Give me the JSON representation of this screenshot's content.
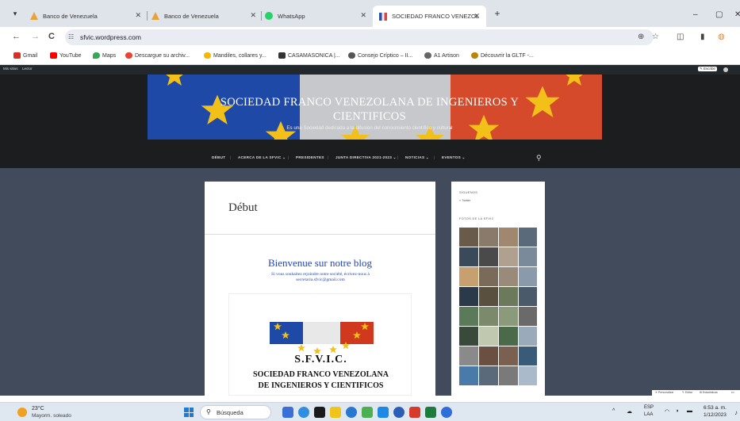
{
  "browser": {
    "tabs": [
      {
        "label": "Banco de Venezuela",
        "favicon_color": "#e8a33c"
      },
      {
        "label": "Banco de Venezuela",
        "favicon_color": "#e8a33c"
      },
      {
        "label": "WhatsApp",
        "favicon_color": "#25d366"
      },
      {
        "label": "SOCIEDAD FRANCO VENEZOLA",
        "favicon_color": "#c0392b"
      }
    ],
    "url": "sfvic.wordpress.com",
    "icons": {
      "tab_menu": "▾",
      "close": "✕",
      "new_tab": "+",
      "minimize": "–",
      "maximize": "▢",
      "back": "←",
      "forward": "→",
      "reload": "C",
      "tune": "☷",
      "zoom": "⊕",
      "star": "☆",
      "extensions": "◫",
      "sidepanel": "▮",
      "profile": "◍"
    }
  },
  "bookmarks": [
    {
      "label": "Gmail",
      "color": "#d93025"
    },
    {
      "label": "YouTube",
      "color": "#ff0000"
    },
    {
      "label": "Maps",
      "color": "#34a853"
    },
    {
      "label": "Descargue su archiv...",
      "color": "#ea4335"
    },
    {
      "label": "Mandiles, collares y...",
      "color": "#f2b900"
    },
    {
      "label": "CASAMASONICA |...",
      "color": "#333333"
    },
    {
      "label": "Consejo Críptico – II...",
      "color": "#555555"
    },
    {
      "label": "A1 Artison",
      "color": "#666666"
    },
    {
      "label": "Découvrir la GLTF -...",
      "color": "#b8860b"
    }
  ],
  "wpbar": {
    "my_sites": "Mis sitios",
    "reader": "Lector",
    "write": "✎ Escribir"
  },
  "site": {
    "title": "SOCIEDAD FRANCO VENEZOLANA DE INGENIEROS Y CIENTIFICOS",
    "tagline": "Es una Sociedad dedicada a la difusión del conocimiento científico y cultural",
    "nav": [
      "DÉBUT",
      "ACERCA DE LA SFVIC ⌄",
      "PRESIDENTES",
      "JUNTA DIRECTIVA 2021-2023 ⌄",
      "NOTICIAS ⌄",
      "EVENTOS ⌄"
    ],
    "search_icon": "⚲"
  },
  "main": {
    "page_title": "Début",
    "welcome": "Bienvenue sur notre blog",
    "subline": "Si vous souhaitez rejoindre notre société, écrivez-nous à secretaria.sfvic@gmail.com",
    "logo_title": "S.F.V.I.C.",
    "org_line1": "SOCIEDAD FRANCO VENEZOLANA",
    "org_line2": "DE INGENIEROS Y CIENTIFICOS"
  },
  "sidebar": {
    "h1": "SÍGUENOS",
    "link1": "» Twitter",
    "h2": "FOTOS DE LA SFVIC",
    "photo_colors": [
      "#6a5a4a",
      "#8a7a6a",
      "#a08870",
      "#5a6a7a",
      "#3a4a5a",
      "#4a4a4a",
      "#b0a090",
      "#7a8a9a",
      "#c8a070",
      "#7a6a5a",
      "#9a8a7a",
      "#8a9aaa",
      "#2a3a4a",
      "#5a5040",
      "#6a7a5a",
      "#4a5a6a",
      "#5a7a5a",
      "#7a8a6a",
      "#8a9a7a",
      "#6a6a6a",
      "#3a4a3a",
      "#c0c8b0",
      "#4a6a4a",
      "#9aaaba",
      "#8a8a8a",
      "#6a5040",
      "#7a6050",
      "#3a5a7a",
      "#4a7aaa",
      "#5a6a7a",
      "#7a7a7a",
      "#aabaca"
    ]
  },
  "float": {
    "item1": "✕ Personalizar",
    "item2": "✎ Editar",
    "item3": "⊞ Estadísticas",
    "item4": "•••"
  },
  "taskbar": {
    "temp": "23°C",
    "condition": "Mayorm. soleado",
    "search": "Búsqueda",
    "app_colors": [
      "#3b6fd8",
      "#2f8ee0",
      "#1b1b1b",
      "#f0c419",
      "#2878d0",
      "#4caf50",
      "#1e88e5",
      "#2b5fb6",
      "#d63a2a",
      "#1c7c3c",
      "#2d6ed8"
    ],
    "lang1": "ESP",
    "lang2": "LAA",
    "time": "6:53 a. m.",
    "date": "1/12/2023",
    "chevron": "^",
    "tray_icons": "☁ ⊜ ◗ ▬"
  }
}
